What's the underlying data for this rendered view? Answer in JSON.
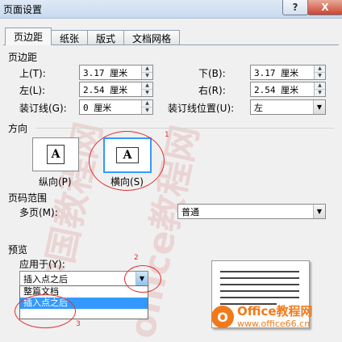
{
  "window": {
    "title": "页面设置",
    "help_label": "?",
    "close_label": "X"
  },
  "tabs": [
    {
      "label": "页边距",
      "active": true
    },
    {
      "label": "纸张",
      "active": false
    },
    {
      "label": "版式",
      "active": false
    },
    {
      "label": "文档网格",
      "active": false
    }
  ],
  "margins": {
    "section_title": "页边距",
    "top": {
      "label": "上(T):",
      "value": "3.17 厘米"
    },
    "bottom": {
      "label": "下(B):",
      "value": "3.17 厘米"
    },
    "left": {
      "label": "左(L):",
      "value": "2.54 厘米"
    },
    "right": {
      "label": "右(R):",
      "value": "2.54 厘米"
    },
    "gutter": {
      "label": "装订线(G):",
      "value": "0 厘米"
    },
    "gutter_pos": {
      "label": "装订线位置(U):",
      "value": "左"
    }
  },
  "orientation": {
    "section_title": "方向",
    "portrait_label": "纵向(P)",
    "landscape_label": "横向(S)",
    "icon_letter": "A",
    "selected": "landscape"
  },
  "pages": {
    "section_title": "页码范围",
    "multiple_label": "多页(M):",
    "multiple_value": "普通"
  },
  "preview": {
    "section_title": "预览",
    "apply_label": "应用于(Y):",
    "apply_value": "插入点之后",
    "options": [
      "整篇文档",
      "插入点之后"
    ]
  },
  "annotations": {
    "n1": "1",
    "n2": "2",
    "n3": "3"
  },
  "watermark": {
    "lines": [
      "中国教程网",
      "office教程网"
    ],
    "logo_text": "Office教程网",
    "logo_url": "www.office66.cn"
  },
  "colors": {
    "accent": "#3399ff",
    "annotation_red": "#e03030",
    "logo_orange": "#f07a1a"
  }
}
